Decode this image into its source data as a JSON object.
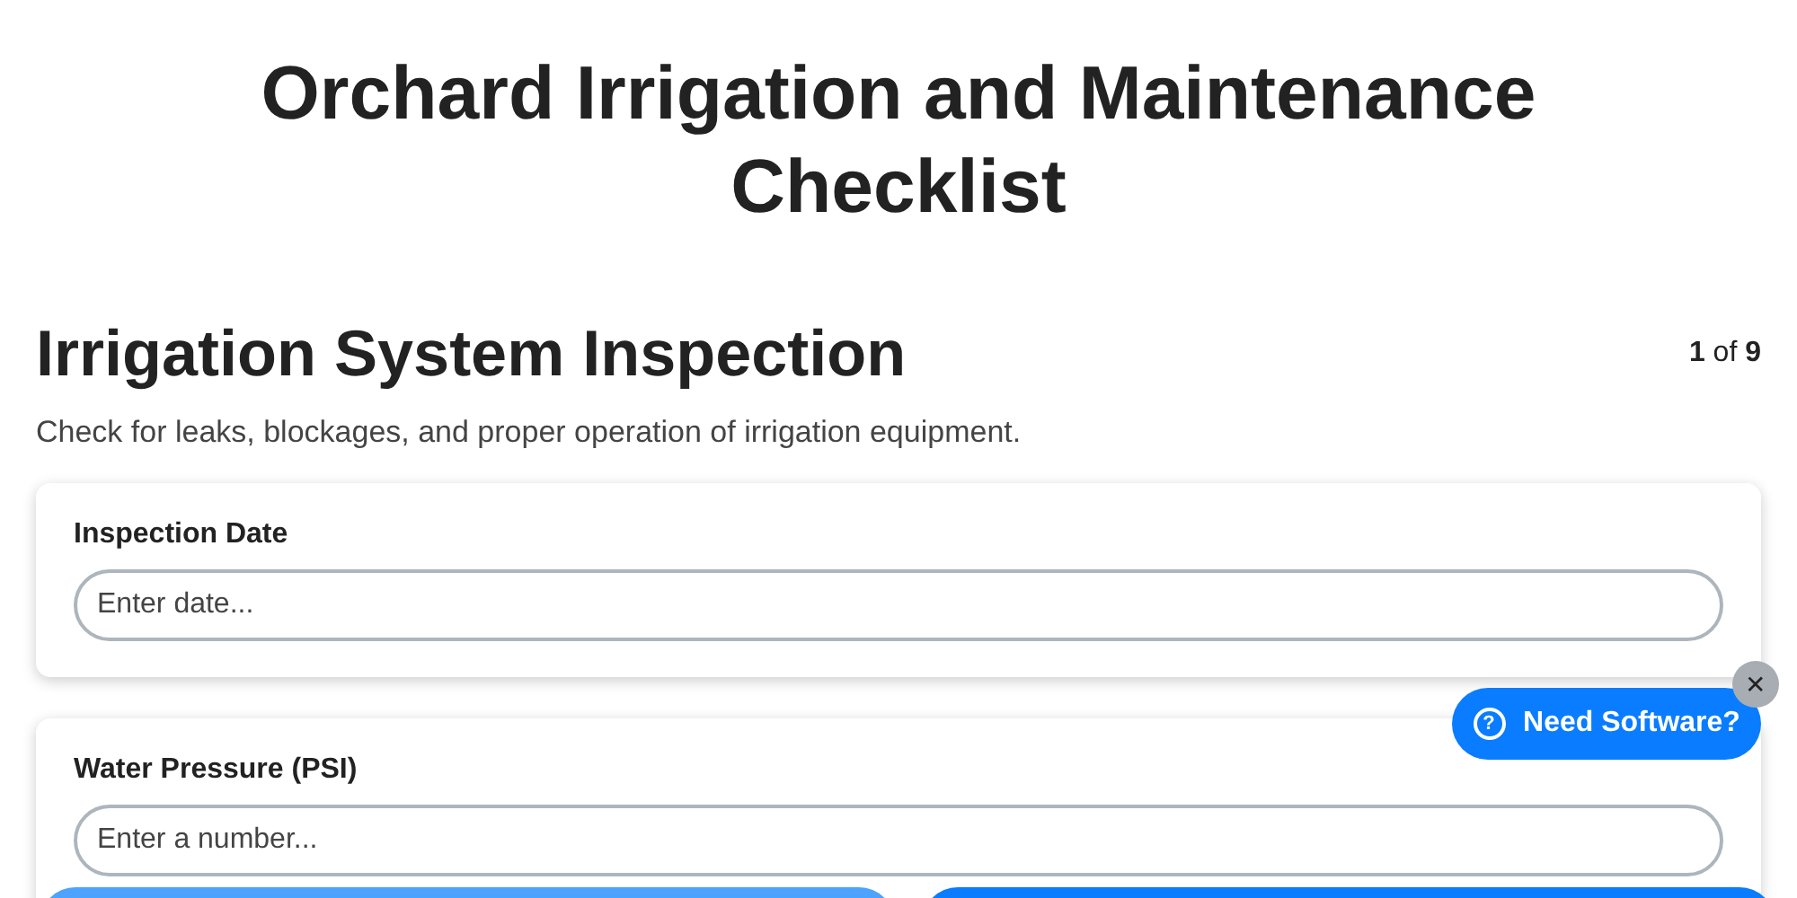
{
  "title": "Orchard Irrigation and Maintenance Checklist",
  "section": {
    "heading": "Irrigation System Inspection",
    "page_current": "1",
    "page_of": "of",
    "page_total": "9",
    "description": "Check for leaks, blockages, and proper operation of irrigation equipment."
  },
  "fields": [
    {
      "label": "Inspection Date",
      "placeholder": "Enter date..."
    },
    {
      "label": "Water Pressure (PSI)",
      "placeholder": "Enter a number..."
    }
  ],
  "nav_buttons": [
    {
      "kind": "secondary"
    },
    {
      "kind": "primary"
    }
  ],
  "help_button": {
    "icon": "?",
    "label": "Need Software?",
    "close": "✕"
  }
}
